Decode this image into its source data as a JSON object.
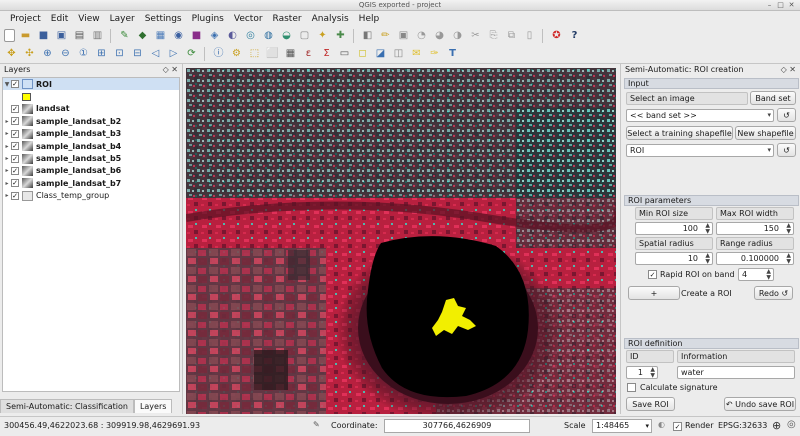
{
  "window": {
    "title": "QGIS exported - project"
  },
  "menubar": [
    "Project",
    "Edit",
    "View",
    "Layer",
    "Settings",
    "Plugins",
    "Vector",
    "Raster",
    "Analysis",
    "Help"
  ],
  "layers_panel": {
    "title": "Layers",
    "layers": [
      {
        "name": "ROI",
        "checked": true,
        "selected": true,
        "kind": "vector"
      },
      {
        "name": "",
        "checked": false,
        "kind": "symbol"
      },
      {
        "name": "landsat",
        "checked": true,
        "kind": "raster"
      },
      {
        "name": "sample_landsat_b2",
        "checked": true,
        "kind": "raster"
      },
      {
        "name": "sample_landsat_b3",
        "checked": true,
        "kind": "raster"
      },
      {
        "name": "sample_landsat_b4",
        "checked": true,
        "kind": "raster"
      },
      {
        "name": "sample_landsat_b5",
        "checked": true,
        "kind": "raster"
      },
      {
        "name": "sample_landsat_b6",
        "checked": true,
        "kind": "raster"
      },
      {
        "name": "sample_landsat_b7",
        "checked": true,
        "kind": "raster"
      },
      {
        "name": "Class_temp_group",
        "checked": true,
        "kind": "group"
      }
    ],
    "tabs": [
      "Semi-Automatic: Classification",
      "Layers"
    ]
  },
  "roi_panel": {
    "title": "Semi-Automatic: ROI creation",
    "input": {
      "header": "Input",
      "select_image_label": "Select an image",
      "band_set_button": "Band set",
      "image_combo": "<< band set >>",
      "select_shapefile_label": "Select a training shapefile",
      "new_shapefile_button": "New shapefile",
      "shapefile_combo": "ROI",
      "refresh_glyph": "↺"
    },
    "roi_parameters": {
      "header": "ROI parameters",
      "min_roi_size_label": "Min ROI size",
      "min_roi_size": "100",
      "max_roi_width_label": "Max ROI width",
      "max_roi_width": "150",
      "spatial_radius_label": "Spatial radius",
      "spatial_radius": "10",
      "range_radius_label": "Range radius",
      "range_radius": "0.100000",
      "rapid_roi_label": "Rapid ROI on band",
      "rapid_roi_checked": true,
      "rapid_band": "4",
      "plus_button": "+",
      "create_roi_label": "Create a ROI",
      "redo_button": "Redo ↺"
    },
    "roi_definition": {
      "header": "ROI definition",
      "id_label": "ID",
      "id_value": "1",
      "information_label": "Information",
      "information_value": "water",
      "calculate_signature_label": "Calculate signature",
      "calculate_signature_checked": false,
      "save_roi_button": "Save ROI",
      "undo_save_roi_button": "↶ Undo save ROI"
    }
  },
  "statusbar": {
    "extent": "300456.49,4622023.68 : 309919.98,4629691.93",
    "coordinate_label": "Coordinate:",
    "coordinate_value": "307766,4626909",
    "scale_label": "Scale",
    "scale_value": "1:48465",
    "render_label": "Render",
    "render_checked": true,
    "crs": "EPSG:32633"
  }
}
